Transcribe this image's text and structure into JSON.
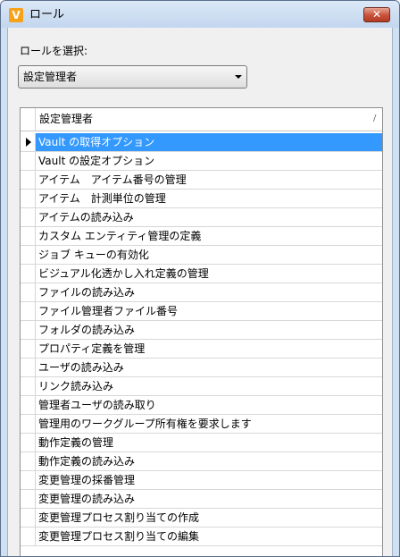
{
  "window": {
    "title": "ロール",
    "app_icon_letter": "V",
    "close_glyph": "✕"
  },
  "role_selector": {
    "label": "ロールを選択:",
    "selected": "設定管理者"
  },
  "grid": {
    "header": "設定管理者",
    "sort_glyph": "/",
    "selected_index": 0,
    "rows": [
      "Vault の取得オプション",
      "Vault の設定オプション",
      "アイテム　アイテム番号の管理",
      "アイテム　計測単位の管理",
      "アイテムの読み込み",
      "カスタム エンティティ管理の定義",
      "ジョブ キューの有効化",
      "ビジュアル化透かし入れ定義の管理",
      "ファイルの読み込み",
      "ファイル管理者ファイル番号",
      "フォルダの読み込み",
      "プロパティ定義を管理",
      "ユーザの読み込み",
      "リンク読み込み",
      "管理者ユーザの読み取り",
      "管理用のワークグループ所有権を要求します",
      "動作定義の管理",
      "動作定義の読み込み",
      "変更管理の採番管理",
      "変更管理の読み込み",
      "変更管理プロセス割り当ての作成",
      "変更管理プロセス割り当ての編集"
    ]
  },
  "colors": {
    "selection": "#3399ff",
    "title_bar": "#c2d6ee",
    "close_button": "#c8513b",
    "app_icon": "#f7a21b"
  }
}
